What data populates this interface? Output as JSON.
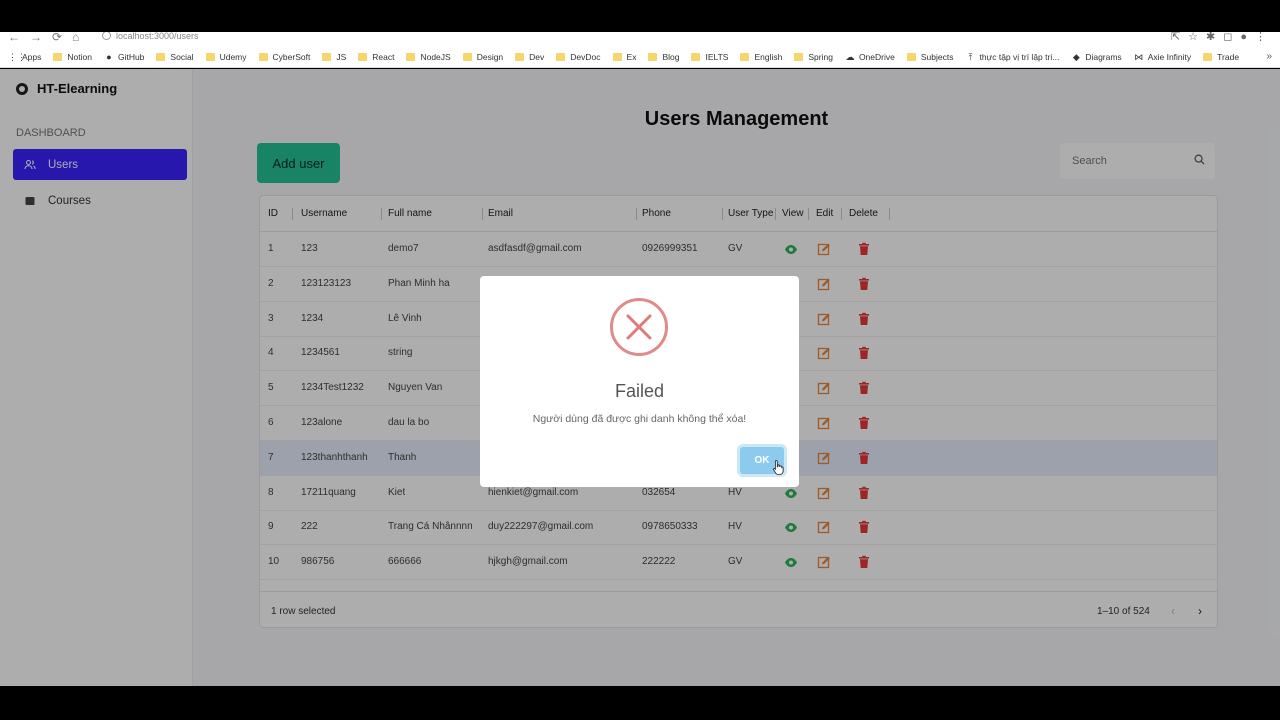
{
  "browser": {
    "url": "localhost:3000/users",
    "bookmarks": [
      "Apps",
      "Notion",
      "GitHub",
      "Social",
      "Udemy",
      "CyberSoft",
      "JS",
      "React",
      "NodeJS",
      "Design",
      "Dev",
      "DevDoc",
      "Ex",
      "Blog",
      "IELTS",
      "English",
      "Spring",
      "OneDrive",
      "Subjects",
      "thực tập vị trí lập tri...",
      "Diagrams",
      "Axie Infinity",
      "Trade"
    ]
  },
  "sidebar": {
    "brand": "HT-Elearning",
    "section": "DASHBOARD",
    "items": [
      {
        "label": "Users",
        "icon": "users-icon",
        "active": true
      },
      {
        "label": "Courses",
        "icon": "book-icon",
        "active": false
      }
    ]
  },
  "main": {
    "title": "Users Management",
    "add_button": "Add user",
    "search_placeholder": "Search"
  },
  "table": {
    "columns": [
      "ID",
      "Username",
      "Full name",
      "Email",
      "Phone",
      "User Type",
      "View",
      "Edit",
      "Delete"
    ],
    "rows": [
      {
        "id": "1",
        "username": "123",
        "fullname": "demo7",
        "email": "asdfasdf@gmail.com",
        "phone": "0926999351",
        "type": "GV"
      },
      {
        "id": "2",
        "username": "123123123",
        "fullname": "Phan Minh ha",
        "email": "",
        "phone": "",
        "type": ""
      },
      {
        "id": "3",
        "username": "1234",
        "fullname": "Lê Vinh",
        "email": "",
        "phone": "",
        "type": ""
      },
      {
        "id": "4",
        "username": "1234561",
        "fullname": "string",
        "email": "",
        "phone": "",
        "type": ""
      },
      {
        "id": "5",
        "username": "1234Test1232",
        "fullname": "Nguyen Van",
        "email": "",
        "phone": "",
        "type": ""
      },
      {
        "id": "6",
        "username": "123alone",
        "fullname": "dau la bo",
        "email": "",
        "phone": "",
        "type": ""
      },
      {
        "id": "7",
        "username": "123thanhthanh",
        "fullname": "Thanh",
        "email": "",
        "phone": "",
        "type": ""
      },
      {
        "id": "8",
        "username": "17211quang",
        "fullname": "Kiet",
        "email": "hienkiet@gmail.com",
        "phone": "032654",
        "type": "HV"
      },
      {
        "id": "9",
        "username": "222",
        "fullname": "Trang Cá Nhânnnn",
        "email": "duy222297@gmail.com",
        "phone": "0978650333",
        "type": "HV"
      },
      {
        "id": "10",
        "username": "986756",
        "fullname": "666666",
        "email": "hjkgh@gmail.com",
        "phone": "222222",
        "type": "GV"
      }
    ],
    "selected_row_index": 6,
    "footer": {
      "selected": "1 row selected",
      "range": "1–10 of 524"
    }
  },
  "modal": {
    "title": "Failed",
    "message": "Người dùng đã được ghi danh không thể xóa!",
    "ok_label": "OK"
  },
  "colors": {
    "sidebar_active": "#3a22ff",
    "add_button": "#25c195",
    "view_icon": "#2bb55a",
    "edit_icon": "#e8863a",
    "delete_icon": "#e53935",
    "error": "#e08a8a",
    "ok_button": "#8ccbee"
  }
}
